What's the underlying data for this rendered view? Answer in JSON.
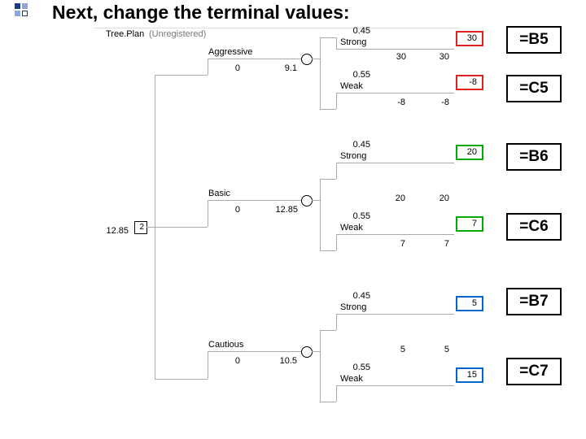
{
  "title": "Next, change the terminal values:",
  "tree": {
    "app_name": "Tree.Plan",
    "reg": "(Unregistered)",
    "root": {
      "ev": "12.85",
      "choice": "2"
    },
    "branches": [
      {
        "label": "Aggressive",
        "cost": "0",
        "ev": "9.1",
        "outcomes": [
          {
            "label": "Strong",
            "prob": "0.45",
            "value": "30",
            "terminal": "30"
          },
          {
            "label": "Weak",
            "prob": "0.55",
            "value": "-8",
            "terminal": "-8"
          }
        ]
      },
      {
        "label": "Basic",
        "cost": "0",
        "ev": "12.85",
        "outcomes": [
          {
            "label": "Strong",
            "prob": "0.45",
            "value": "20",
            "terminal": "20"
          },
          {
            "label": "Weak",
            "prob": "0.55",
            "value": "7",
            "terminal": "7"
          }
        ]
      },
      {
        "label": "Cautious",
        "cost": "0",
        "ev": "10.5",
        "outcomes": [
          {
            "label": "Strong",
            "prob": "0.45",
            "value": "5",
            "terminal": "5"
          },
          {
            "label": "Weak",
            "prob": "0.55",
            "value": "",
            "terminal": "15"
          }
        ]
      }
    ]
  },
  "refs": [
    "=B5",
    "=C5",
    "=B6",
    "=C6",
    "=B7",
    "=C7"
  ]
}
